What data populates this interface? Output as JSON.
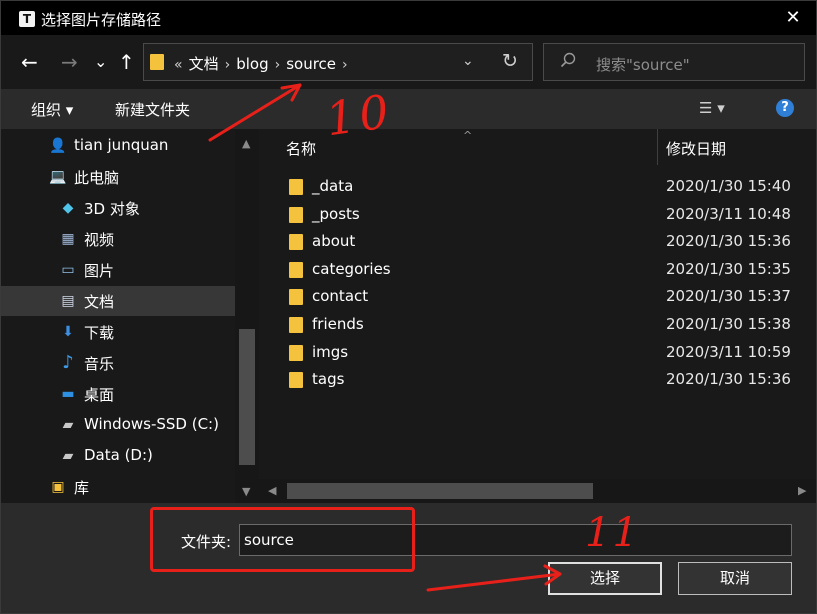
{
  "window": {
    "title": "选择图片存储路径",
    "app_icon_letter": "T",
    "close_glyph": "✕"
  },
  "nav": {
    "back": "←",
    "forward": "→",
    "recent": "⌄",
    "up": "↑",
    "breadcrumb_overflow": "«",
    "breadcrumbs": [
      "文档",
      "blog",
      "source"
    ],
    "separator": "›",
    "dropdown": "⌄",
    "refresh": "↻"
  },
  "search": {
    "placeholder": "搜索\"source\""
  },
  "toolbar": {
    "organize": "组织 ▾",
    "new_folder": "新建文件夹",
    "view": "☰ ▾",
    "help": "?"
  },
  "sidebar": {
    "items": [
      {
        "label": "tian junquan",
        "icon": "user-icon",
        "glyph": "👤"
      },
      {
        "label": "此电脑",
        "icon": "computer-icon",
        "glyph": "💻"
      },
      {
        "label": "3D 对象",
        "icon": "cube-icon",
        "glyph": "◆"
      },
      {
        "label": "视频",
        "icon": "film-icon",
        "glyph": "▦"
      },
      {
        "label": "图片",
        "icon": "picture-icon",
        "glyph": "▭"
      },
      {
        "label": "文档",
        "icon": "document-icon",
        "glyph": "▤"
      },
      {
        "label": "下载",
        "icon": "download-icon",
        "glyph": "⬇"
      },
      {
        "label": "音乐",
        "icon": "music-icon",
        "glyph": "♪"
      },
      {
        "label": "桌面",
        "icon": "desktop-icon",
        "glyph": "▬"
      },
      {
        "label": "Windows-SSD (C:)",
        "icon": "drive-icon",
        "glyph": "▰"
      },
      {
        "label": "Data (D:)",
        "icon": "drive-icon",
        "glyph": "▰"
      },
      {
        "label": "库",
        "icon": "library-icon",
        "glyph": "▣"
      }
    ],
    "scroll_up": "▲",
    "scroll_down": "▼"
  },
  "files": {
    "columns": [
      "名称",
      "修改日期"
    ],
    "sort_indicator": "^",
    "rows": [
      {
        "name": "_data",
        "date": "2020/1/30 15:40"
      },
      {
        "name": "_posts",
        "date": "2020/3/11 10:48"
      },
      {
        "name": "about",
        "date": "2020/1/30 15:36"
      },
      {
        "name": "categories",
        "date": "2020/1/30 15:35"
      },
      {
        "name": "contact",
        "date": "2020/1/30 15:37"
      },
      {
        "name": "friends",
        "date": "2020/1/30 15:38"
      },
      {
        "name": "imgs",
        "date": "2020/3/11 10:59"
      },
      {
        "name": "tags",
        "date": "2020/1/30 15:36"
      }
    ],
    "scroll_left": "◀",
    "scroll_right": "▶"
  },
  "footer": {
    "folder_label": "文件夹:",
    "folder_value": "source",
    "select_button": "选择",
    "cancel_button": "取消"
  },
  "annotations": {
    "step_a": "10",
    "step_b": "11",
    "color": "#e8201a"
  }
}
